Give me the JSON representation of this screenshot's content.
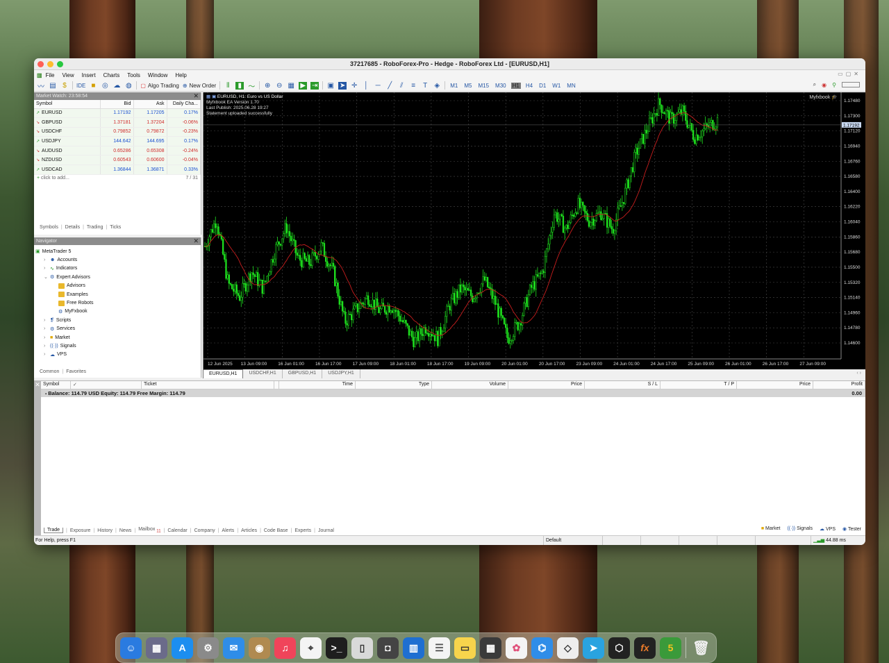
{
  "window": {
    "title": "37217685 - RoboForex-Pro - Hedge - RoboForex Ltd - [EURUSD,H1]"
  },
  "menu": [
    "File",
    "View",
    "Insert",
    "Charts",
    "Tools",
    "Window",
    "Help"
  ],
  "toolbar": {
    "ide": "IDE",
    "algo_trading": "Algo Trading",
    "new_order": "New Order",
    "timeframes": [
      "M1",
      "M5",
      "M15",
      "M30",
      "H1",
      "H4",
      "D1",
      "W1",
      "MN"
    ],
    "active_timeframe": "H1"
  },
  "market_watch": {
    "title": "Market Watch: 23:58:54",
    "columns": [
      "Symbol",
      "Bid",
      "Ask",
      "Daily Cha..."
    ],
    "rows": [
      {
        "symbol": "EURUSD",
        "bid": "1.17192",
        "ask": "1.17205",
        "change": "0.17%",
        "dir": "up"
      },
      {
        "symbol": "GBPUSD",
        "bid": "1.37181",
        "ask": "1.37204",
        "change": "-0.06%",
        "dir": "down"
      },
      {
        "symbol": "USDCHF",
        "bid": "0.79852",
        "ask": "0.79872",
        "change": "-0.23%",
        "dir": "down"
      },
      {
        "symbol": "USDJPY",
        "bid": "144.642",
        "ask": "144.695",
        "change": "0.17%",
        "dir": "up"
      },
      {
        "symbol": "AUDUSD",
        "bid": "0.65286",
        "ask": "0.65308",
        "change": "-0.24%",
        "dir": "down"
      },
      {
        "symbol": "NZDUSD",
        "bid": "0.60543",
        "ask": "0.60600",
        "change": "-0.04%",
        "dir": "down"
      },
      {
        "symbol": "USDCAD",
        "bid": "1.36844",
        "ask": "1.36871",
        "change": "0.33%",
        "dir": "up"
      }
    ],
    "add": "click to add...",
    "count": "7 / 31",
    "tabs": [
      "Symbols",
      "Details",
      "Trading",
      "Ticks"
    ]
  },
  "navigator": {
    "title": "Navigator",
    "items": [
      {
        "label": "MetaTrader 5",
        "level": 0,
        "icon": "mt5-icon"
      },
      {
        "label": "Accounts",
        "level": 1,
        "icon": "accounts-icon"
      },
      {
        "label": "Indicators",
        "level": 1,
        "icon": "indicators-icon"
      },
      {
        "label": "Expert Advisors",
        "level": 1,
        "icon": "experts-icon"
      },
      {
        "label": "Advisors",
        "level": 2,
        "icon": "folder-icon"
      },
      {
        "label": "Examples",
        "level": 2,
        "icon": "folder-icon"
      },
      {
        "label": "Free Robots",
        "level": 2,
        "icon": "folder-icon"
      },
      {
        "label": "MyFxbook",
        "level": 2,
        "icon": "ea-icon"
      },
      {
        "label": "Scripts",
        "level": 1,
        "icon": "scripts-icon"
      },
      {
        "label": "Services",
        "level": 1,
        "icon": "services-icon"
      },
      {
        "label": "Market",
        "level": 1,
        "icon": "market-icon"
      },
      {
        "label": "Signals",
        "level": 1,
        "icon": "signals-icon"
      },
      {
        "label": "VPS",
        "level": 1,
        "icon": "vps-icon"
      }
    ],
    "tabs": [
      "Common",
      "Favorites"
    ]
  },
  "chart": {
    "symbol_line": "EURUSD, H1:  Euro vs US Dollar",
    "info": [
      "Myfxbook EA Version 1.70",
      "Last Publish: 2025.06.28 19:27",
      "Statement uploaded successfully"
    ],
    "badge": "Myfxbook",
    "price_labels": [
      "1.17480",
      "1.17300",
      "1.17120",
      "1.16940",
      "1.16760",
      "1.16580",
      "1.16400",
      "1.16220",
      "1.16040",
      "1.15860",
      "1.15680",
      "1.15500",
      "1.15320",
      "1.15140",
      "1.14960",
      "1.14780",
      "1.14600"
    ],
    "current_price": "1.17192",
    "time_labels": [
      "12 Jun 2025",
      "13 Jun 09:00",
      "16 Jun 01:00",
      "16 Jun 17:00",
      "17 Jun 09:00",
      "18 Jun 01:00",
      "18 Jun 17:00",
      "19 Jun 09:00",
      "20 Jun 01:00",
      "20 Jun 17:00",
      "23 Jun 09:00",
      "24 Jun 01:00",
      "24 Jun 17:00",
      "25 Jun 09:00",
      "26 Jun 01:00",
      "26 Jun 17:00",
      "27 Jun 09:00"
    ],
    "path": [
      1.1575,
      1.1608,
      1.153,
      1.1515,
      1.1545,
      1.1525,
      1.157,
      1.1598,
      1.156,
      1.1555,
      1.1575,
      1.1545,
      1.1485,
      1.15,
      1.1515,
      1.1498,
      1.1505,
      1.1485,
      1.1462,
      1.148,
      1.1465,
      1.1505,
      1.1525,
      1.1515,
      1.1535,
      1.1505,
      1.1465,
      1.1485,
      1.1525,
      1.1545,
      1.1615,
      1.1595,
      1.1625,
      1.1605,
      1.1615,
      1.1595,
      1.1635,
      1.1685,
      1.1715,
      1.1745,
      1.1725,
      1.1735,
      1.1705,
      1.1715,
      1.1725
    ]
  },
  "chart_tabs": [
    "EURUSD,H1",
    "USDCHF,H1",
    "GBPUSD,H1",
    "USDJPY,H1"
  ],
  "trade": {
    "columns": [
      "Symbol",
      "Ticket",
      "Time",
      "Type",
      "Volume",
      "Price",
      "S / L",
      "T / P",
      "Price",
      "Profit"
    ],
    "balance": "Balance: 114.79 USD  Equity: 114.79  Free Margin: 114.79",
    "profit": "0.00",
    "tabs": [
      "Trade",
      "Exposure",
      "History",
      "News",
      "Mailbox",
      "Calendar",
      "Company",
      "Alerts",
      "Articles",
      "Code Base",
      "Experts",
      "Journal"
    ],
    "mailbox_count": "11",
    "right_tabs": [
      "Market",
      "Signals",
      "VPS",
      "Tester"
    ]
  },
  "status": {
    "help": "For Help, press F1",
    "profile": "Default",
    "ping": "44.88 ms"
  },
  "colors": {
    "bull": "#1ee01e",
    "ma": "#c81e1e",
    "grid": "#4a4a4a"
  }
}
